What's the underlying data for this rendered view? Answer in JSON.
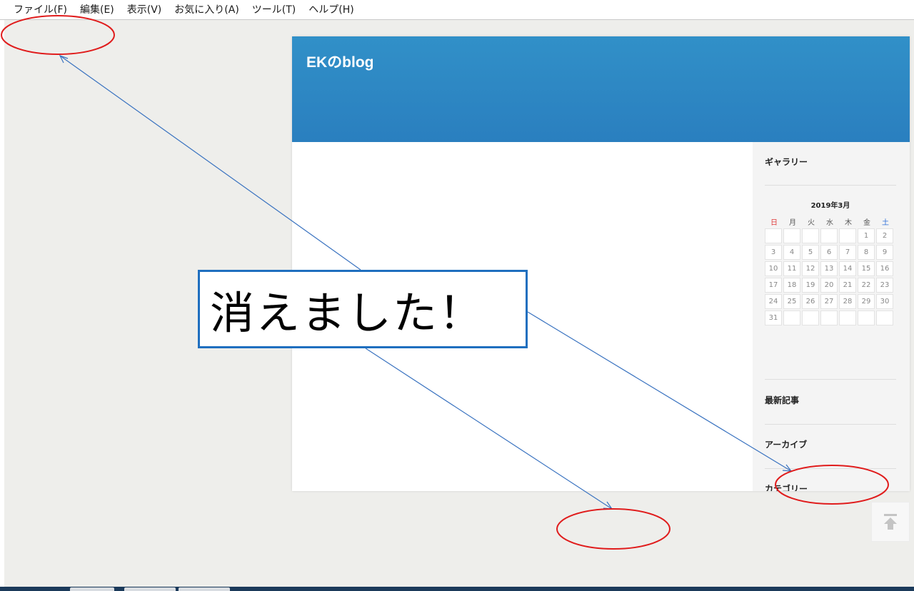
{
  "menubar": {
    "items": [
      "ファイル(F)",
      "編集(E)",
      "表示(V)",
      "お気に入り(A)",
      "ツール(T)",
      "ヘルプ(H)"
    ]
  },
  "blog": {
    "title": "EKのblog",
    "header_color": "#2d88c4"
  },
  "sidebar": {
    "gallery_title": "ギャラリー",
    "calendar": {
      "month_title": "2019年3月",
      "weekdays": [
        "日",
        "月",
        "火",
        "水",
        "木",
        "金",
        "土"
      ],
      "days": [
        "",
        "",
        "",
        "",
        "",
        "1",
        "2",
        "3",
        "4",
        "5",
        "6",
        "7",
        "8",
        "9",
        "10",
        "11",
        "12",
        "13",
        "14",
        "15",
        "16",
        "17",
        "18",
        "19",
        "20",
        "21",
        "22",
        "23",
        "24",
        "25",
        "26",
        "27",
        "28",
        "29",
        "30",
        "31",
        "",
        "",
        "",
        "",
        "",
        ""
      ]
    },
    "latest_title": "最新記事",
    "archive_title": "アーカイブ",
    "category_title": "カテゴリー"
  },
  "annotation": {
    "callout_text": "消えました！",
    "arrow_color": "#3a73c0",
    "ellipse_color": "#e01c1c",
    "callout_border_color": "#1f6fbf"
  },
  "icons": {
    "to_top": "arrow-up-to-line-icon"
  }
}
